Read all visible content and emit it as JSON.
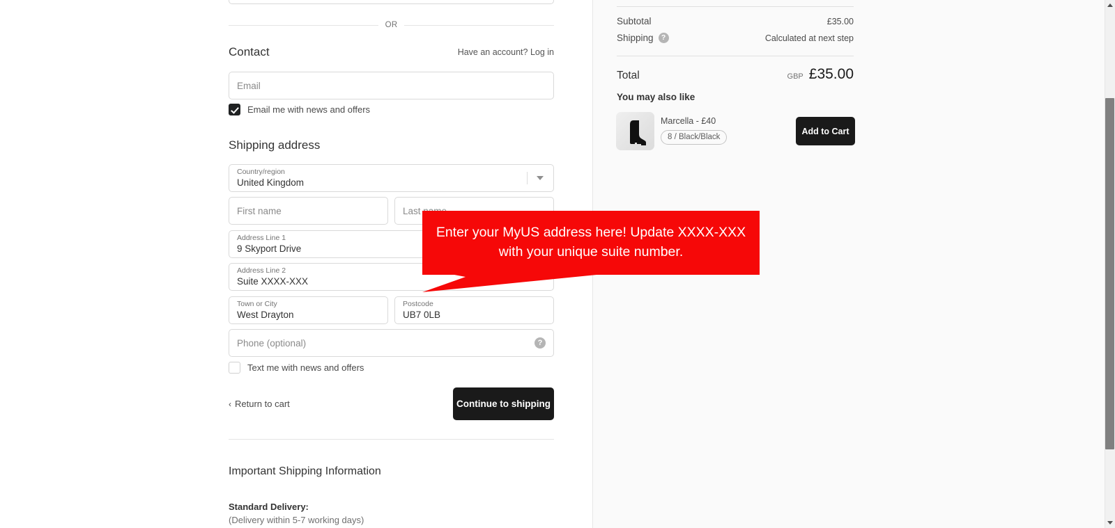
{
  "divider": {
    "or_label": "OR"
  },
  "contact": {
    "title": "Contact",
    "account_prompt": "Have an account?",
    "login_label": "Log in",
    "email_placeholder": "Email",
    "email_optin_label": "Email me with news and offers"
  },
  "shipping": {
    "title": "Shipping address",
    "country": {
      "label": "Country/region",
      "value": "United Kingdom"
    },
    "first_name": {
      "placeholder": "First name",
      "value": ""
    },
    "last_name": {
      "placeholder": "Last name",
      "value": ""
    },
    "address1": {
      "label": "Address Line 1",
      "value": "9 Skyport Drive"
    },
    "address2": {
      "label": "Address Line 2",
      "value": "Suite XXXX-XXX"
    },
    "city": {
      "label": "Town or City",
      "value": "West Drayton"
    },
    "postcode": {
      "label": "Postcode",
      "value": "UB7 0LB"
    },
    "phone": {
      "placeholder": "Phone (optional)",
      "value": "",
      "help_glyph": "?"
    },
    "sms_optin_label": "Text me with news and offers"
  },
  "actions": {
    "return_to_cart": "Return to cart",
    "return_chevron": "‹",
    "continue_label": "Continue to shipping"
  },
  "footer": {
    "title": "Important Shipping Information",
    "standard_delivery_title": "Standard Delivery:",
    "standard_delivery_note": "(Delivery within 5-7 working days)"
  },
  "summary": {
    "subtotal_label": "Subtotal",
    "subtotal_value": "£35.00",
    "shipping_label": "Shipping",
    "shipping_help_glyph": "?",
    "shipping_value": "Calculated at next step",
    "total_label": "Total",
    "total_currency": "GBP",
    "total_amount": "£35.00",
    "upsell_title": "You may also like",
    "upsell_product": "Marcella - £40",
    "upsell_variant": "8 / Black/Black",
    "add_to_cart_label": "Add to Cart"
  },
  "annotation": {
    "text": "Enter your MyUS address here! Update XXXX-XXX with your unique suite number.",
    "color": "#f60808"
  }
}
